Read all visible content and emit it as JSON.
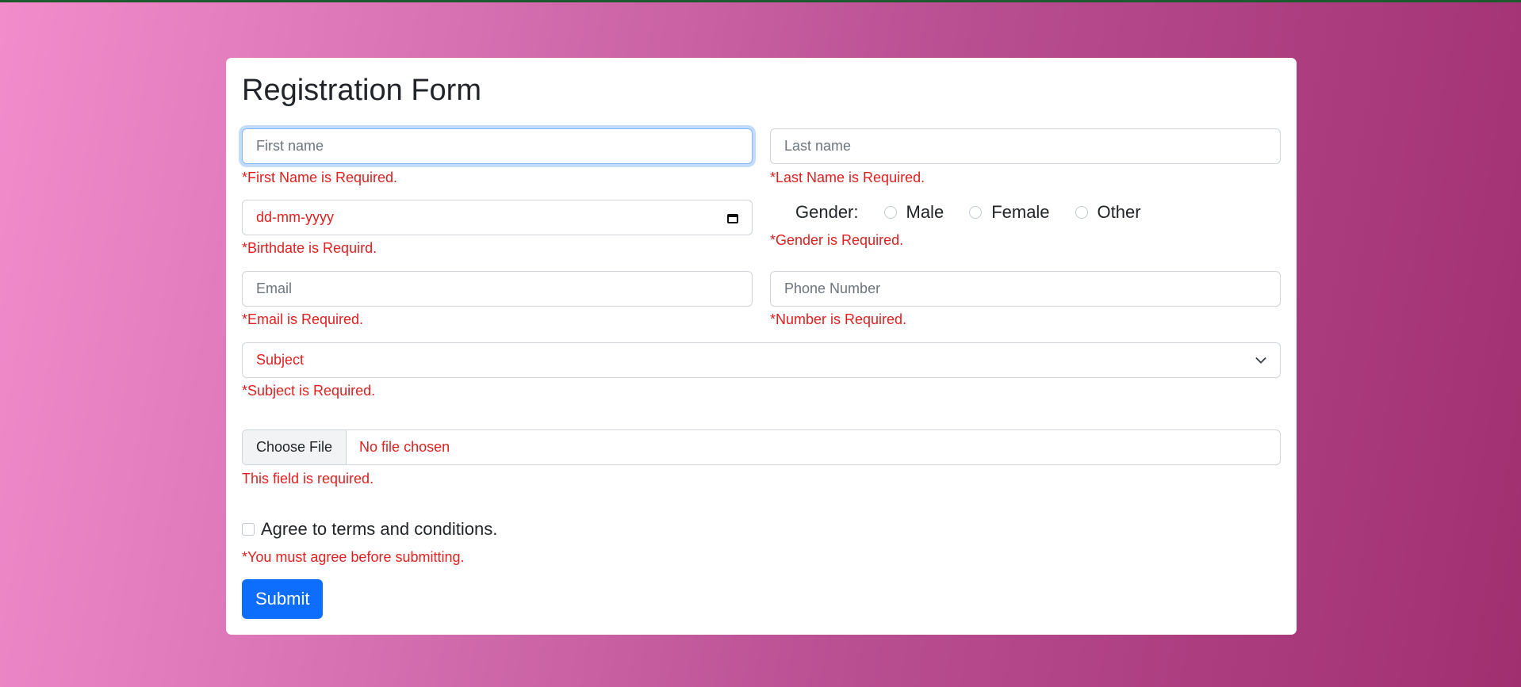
{
  "form": {
    "title": "Registration Form",
    "first_name": {
      "placeholder": "First name",
      "error": "*First Name is Required."
    },
    "last_name": {
      "placeholder": "Last name",
      "error": "*Last Name is Required."
    },
    "birthdate": {
      "placeholder": "dd-mm-yyyy",
      "error": "*Birthdate is Requird."
    },
    "gender": {
      "label": "Gender:",
      "options": [
        "Male",
        "Female",
        "Other"
      ],
      "error": "*Gender is Required."
    },
    "email": {
      "placeholder": "Email",
      "error": "*Email is Required."
    },
    "phone": {
      "placeholder": "Phone Number",
      "error": "*Number is Required."
    },
    "subject": {
      "selected": "Subject",
      "error": "*Subject is Required."
    },
    "file": {
      "button_label": "Choose File",
      "status": "No file chosen",
      "error": "This field is required."
    },
    "terms": {
      "label": "Agree to terms and conditions.",
      "error": "*You must agree before submitting."
    },
    "submit_label": "Submit"
  },
  "colors": {
    "error": "#e01f1f",
    "primary": "#0d6efd",
    "focus_ring": "#86b7fe",
    "background_start": "#f28ccb",
    "background_end": "#a02f70"
  },
  "icons": {
    "calendar": "calendar-icon",
    "chevron": "chevron-down-icon"
  }
}
